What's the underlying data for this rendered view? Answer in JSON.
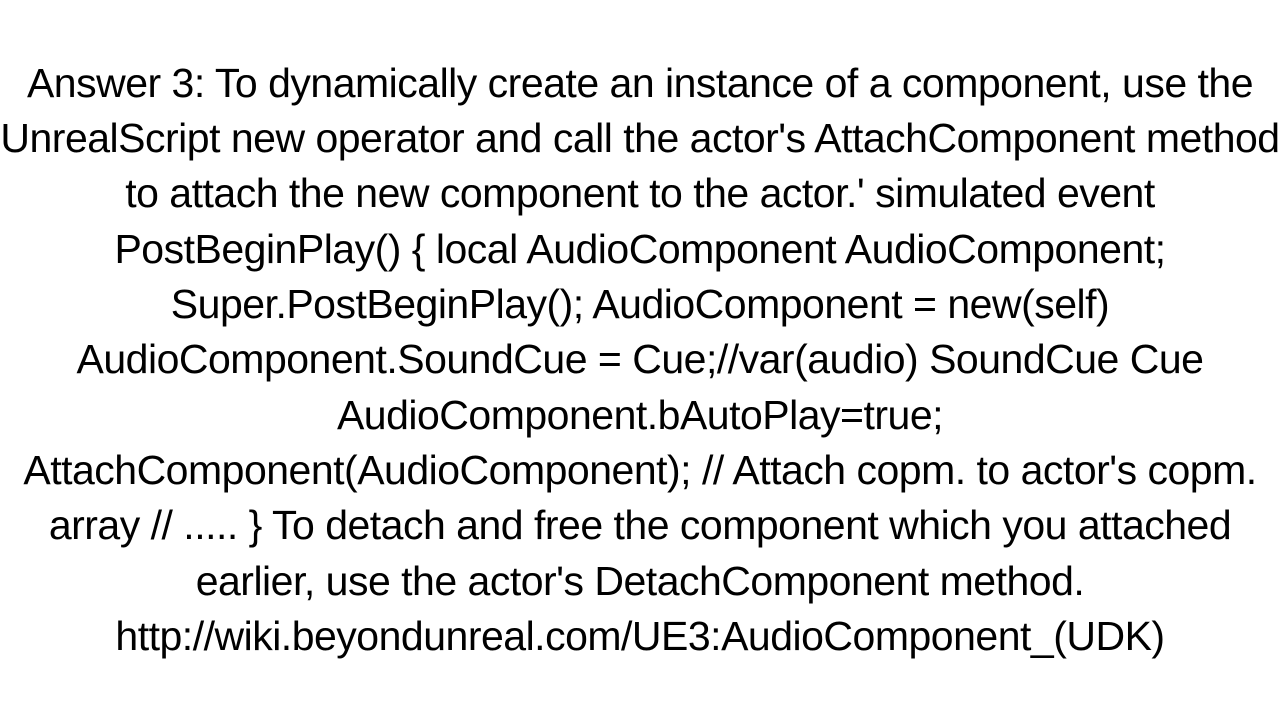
{
  "document": {
    "text": "Answer 3: To dynamically create an instance of a component, use the UnrealScript new operator and call the actor's AttachComponent method to attach the new component to the actor.' simulated event PostBeginPlay() {     local AudioComponent AudioComponent;      Super.PostBeginPlay(); AudioComponent = new(self)     AudioComponent.SoundCue = Cue;//var(audio) SoundCue Cue     AudioComponent.bAutoPlay=true;     AttachComponent(AudioComponent); // Attach copm. to actor's copm. array       // ..... }  To detach and free the component which you attached earlier, use the actor's DetachComponent method. http://wiki.beyondunreal.com/UE3:AudioComponent_(UDK)"
  }
}
